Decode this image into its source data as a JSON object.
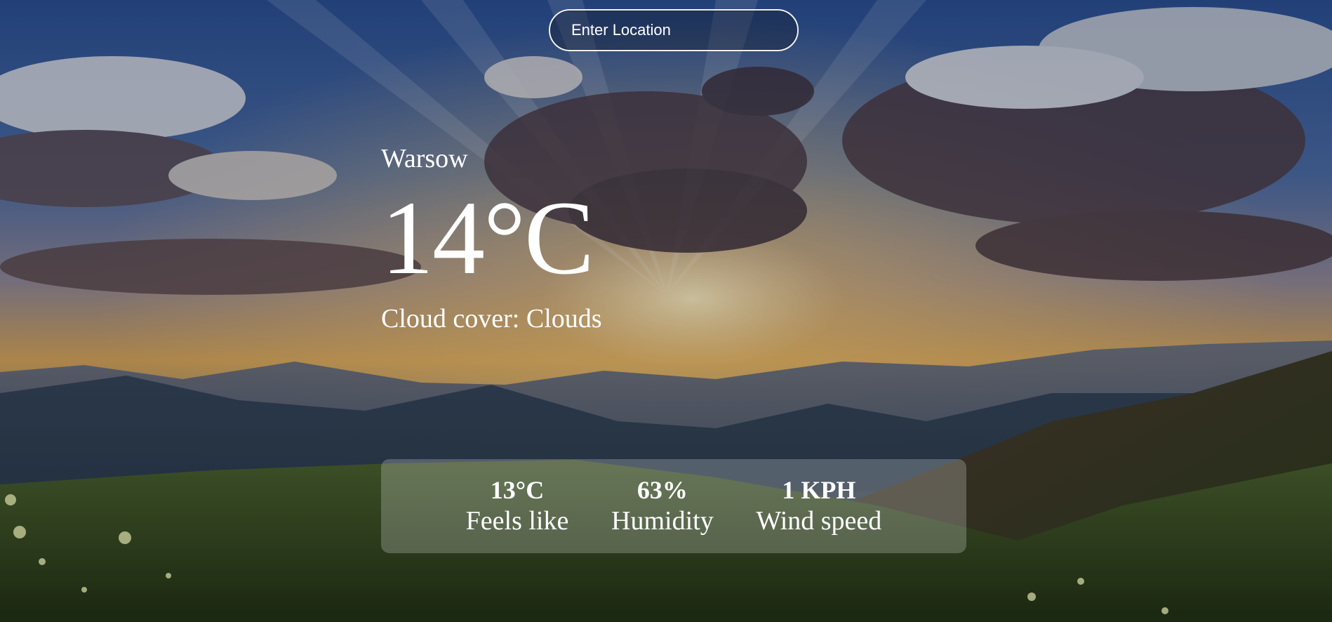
{
  "search": {
    "placeholder": "Enter Location",
    "value": ""
  },
  "weather": {
    "location": "Warsow",
    "temperature": "14°C",
    "description": "Cloud cover: Clouds"
  },
  "stats": {
    "feels_like": {
      "value": "13°C",
      "label": "Feels like"
    },
    "humidity": {
      "value": "63%",
      "label": "Humidity"
    },
    "wind_speed": {
      "value": "1 KPH",
      "label": "Wind speed"
    }
  },
  "colors": {
    "sky_top": "#2d4f8e",
    "sky_glow": "#e0a94a",
    "grass": "#3f5a24",
    "text": "#ffffff"
  }
}
